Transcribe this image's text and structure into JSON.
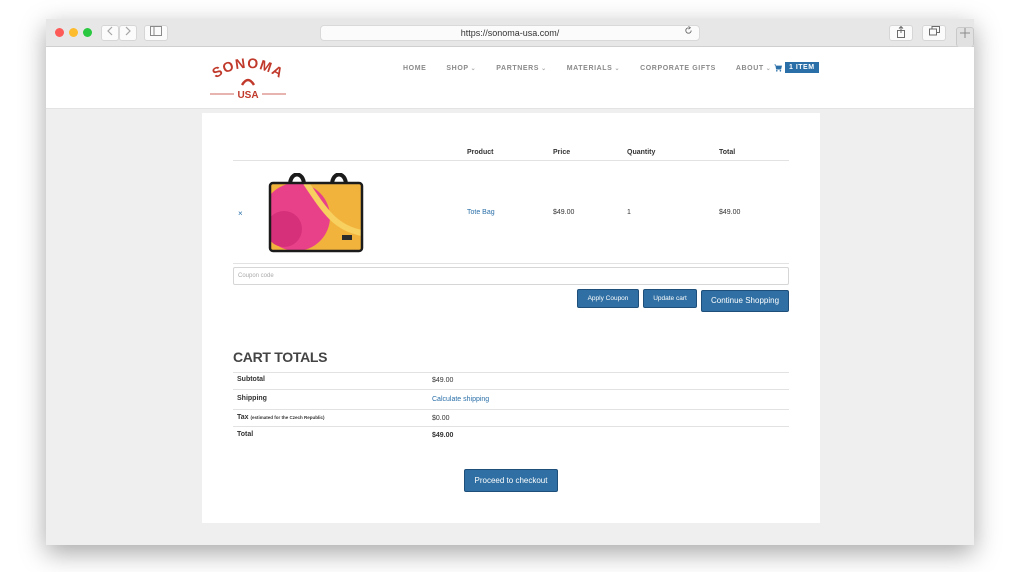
{
  "browser": {
    "url": "https://sonoma-usa.com/"
  },
  "brand": {
    "logo_top": "SONOMA",
    "logo_bottom": "USA",
    "logo_color": "#c0392b"
  },
  "nav": {
    "items": [
      {
        "label": "HOME",
        "has_dropdown": false
      },
      {
        "label": "SHOP",
        "has_dropdown": true
      },
      {
        "label": "PARTNERS",
        "has_dropdown": true
      },
      {
        "label": "MATERIALS",
        "has_dropdown": true
      },
      {
        "label": "CORPORATE GIFTS",
        "has_dropdown": false
      },
      {
        "label": "ABOUT",
        "has_dropdown": true
      }
    ],
    "cart_badge": "1 ITEM",
    "accent_color": "#2f6fa3"
  },
  "cart_table": {
    "headers": [
      "Product",
      "Price",
      "Quantity",
      "Total"
    ],
    "rows": [
      {
        "remove": "×",
        "product": "Tote Bag",
        "price": "$49.00",
        "quantity": "1",
        "total": "$49.00"
      }
    ],
    "coupon_placeholder": "Coupon code",
    "apply_coupon": "Apply Coupon",
    "update_cart": "Update cart",
    "continue_shopping": "Continue Shopping"
  },
  "cart_totals": {
    "title": "CART TOTALS",
    "subtotal_label": "Subtotal",
    "subtotal_value": "$49.00",
    "shipping_label": "Shipping",
    "shipping_value": "Calculate shipping",
    "tax_label": "Tax",
    "tax_note": "(estimated for the Czech Republic)",
    "tax_value": "$0.00",
    "total_label": "Total",
    "total_value": "$49.00",
    "checkout": "Proceed to checkout"
  }
}
